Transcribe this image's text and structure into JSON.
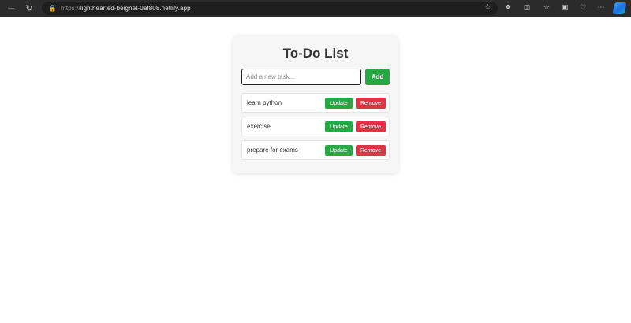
{
  "browser": {
    "url_scheme": "https://",
    "url_host": "lighthearted-beignet-0af808.netlify.app",
    "icons": {
      "back": "back-arrow-icon",
      "reload": "reload-icon",
      "lock": "lock-icon",
      "favorite": "star-icon",
      "extensions": [
        "extensions-icon",
        "split-screen-icon",
        "favorites-icon",
        "collections-icon",
        "browser-essentials-icon",
        "more-icon",
        "copilot-icon"
      ]
    }
  },
  "app": {
    "title": "To-Do List",
    "input": {
      "placeholder": "Add a new task...",
      "value": ""
    },
    "add_label": "Add",
    "tasks": [
      {
        "text": "learn python",
        "update_label": "Update",
        "remove_label": "Remove"
      },
      {
        "text": "exercise",
        "update_label": "Update",
        "remove_label": "Remove"
      },
      {
        "text": "prepare for exams",
        "update_label": "Update",
        "remove_label": "Remove"
      }
    ]
  },
  "colors": {
    "add": "#28a745",
    "update": "#28a745",
    "remove": "#dc3545",
    "card": "#f6f6f6",
    "chrome": "#2b2b2b"
  }
}
